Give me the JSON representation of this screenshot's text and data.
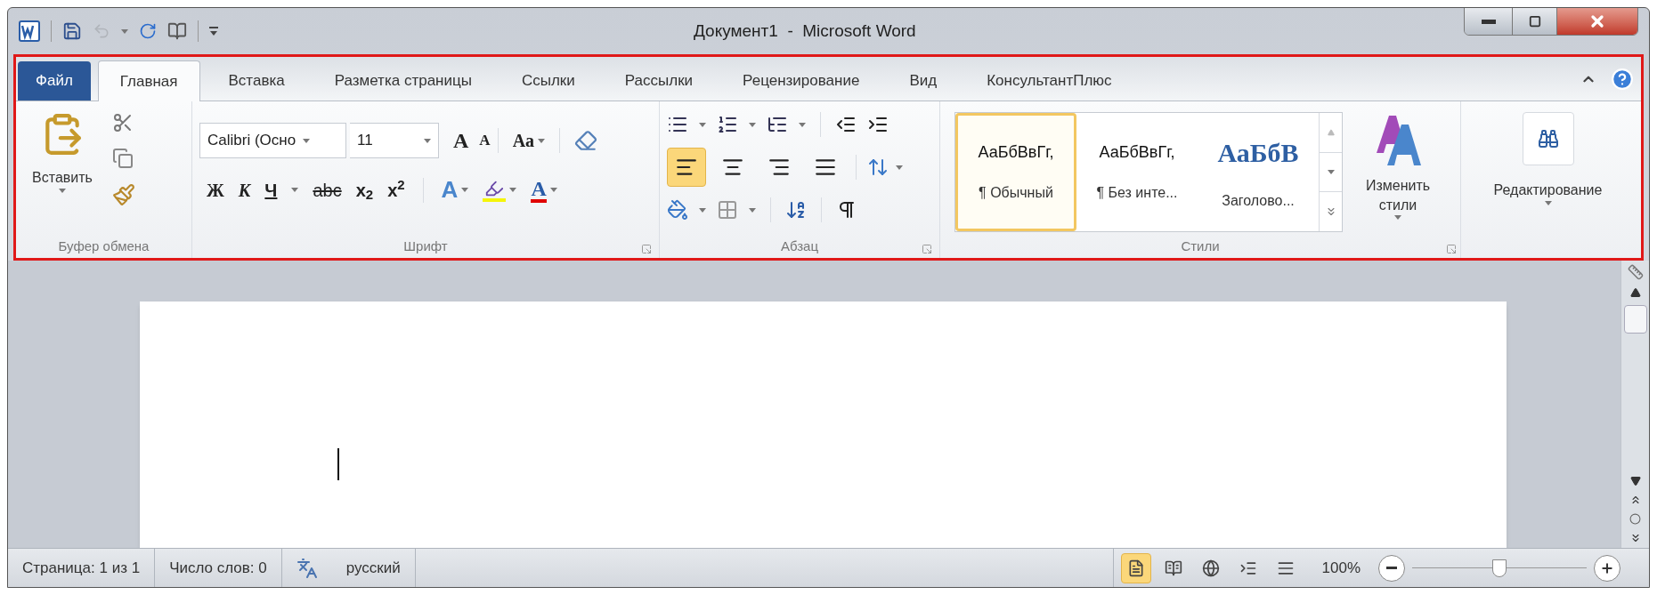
{
  "window": {
    "title": "Документ1  -  Microsoft Word"
  },
  "tabs": [
    {
      "label": "Файл",
      "kind": "file",
      "selected": false
    },
    {
      "label": "Главная",
      "kind": "tab",
      "selected": true
    },
    {
      "label": "Вставка",
      "kind": "tab",
      "selected": false
    },
    {
      "label": "Разметка страницы",
      "kind": "tab",
      "selected": false
    },
    {
      "label": "Ссылки",
      "kind": "tab",
      "selected": false
    },
    {
      "label": "Рассылки",
      "kind": "tab",
      "selected": false
    },
    {
      "label": "Рецензирование",
      "kind": "tab",
      "selected": false
    },
    {
      "label": "Вид",
      "kind": "tab",
      "selected": false
    },
    {
      "label": "КонсультантПлюс",
      "kind": "tab",
      "selected": false
    }
  ],
  "clipboard": {
    "label": "Буфер обмена",
    "paste": "Вставить"
  },
  "font": {
    "label": "Шрифт",
    "family": "Calibri (Осно",
    "size": "11",
    "grow": "A",
    "shrink": "A",
    "change_case": "Aa",
    "text_effect": "A",
    "font_color": "A",
    "format_buttons": [
      {
        "text": "Ж",
        "kind": "bold"
      },
      {
        "text": "К",
        "kind": "italic"
      },
      {
        "text": "Ч",
        "kind": "underline"
      },
      {
        "text": "abc",
        "kind": "strike"
      },
      {
        "text": "x$_{2}$",
        "kind": "sub"
      },
      {
        "text": "x$^{2}$",
        "kind": "sup"
      }
    ]
  },
  "paragraph": {
    "label": "Абзац",
    "alignment": [
      {
        "kind": "left",
        "selected": true
      },
      {
        "kind": "center",
        "selected": false
      },
      {
        "kind": "right",
        "selected": false
      },
      {
        "kind": "justify",
        "selected": false
      }
    ]
  },
  "styles": {
    "label": "Стили",
    "change_styles": "Изменить стили",
    "gallery": [
      {
        "sample": "АаБбВвГг,",
        "name": "¶ Обычный",
        "kind": "body",
        "selected": true
      },
      {
        "sample": "АаБбВвГг,",
        "name": "¶ Без инте...",
        "kind": "body",
        "selected": false
      },
      {
        "sample": "АаБбВ",
        "name": "Заголово...",
        "kind": "heading",
        "selected": false
      }
    ]
  },
  "editing": {
    "label": "Редактирование"
  },
  "status_bar": {
    "page": "Страница: 1 из 1",
    "words": "Число слов: 0",
    "language": "русский",
    "zoom": "100%",
    "zoom_slider": {
      "level": 0.5
    },
    "views": [
      {
        "kind": "print",
        "selected": true
      },
      {
        "kind": "reading",
        "selected": false
      },
      {
        "kind": "web",
        "selected": false
      },
      {
        "kind": "outline",
        "selected": false
      },
      {
        "kind": "draft",
        "selected": false
      }
    ]
  }
}
